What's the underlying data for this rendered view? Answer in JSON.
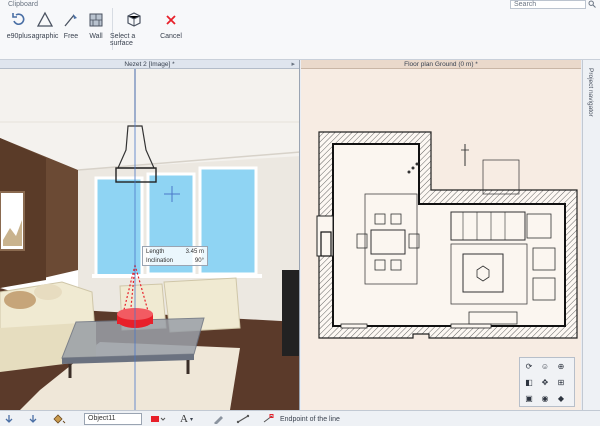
{
  "ribbon": {
    "group_label": "Clipboard",
    "search_placeholder": "Search",
    "tools": [
      {
        "label": "e90plus"
      },
      {
        "label": "agraphic"
      },
      {
        "label": "Free"
      },
      {
        "label": "Wall"
      },
      {
        "label": "Select a surface"
      },
      {
        "label": "Cancel"
      }
    ]
  },
  "view3d": {
    "title": "Nezet 2 [Image] *",
    "measure": {
      "length_label": "Length",
      "length_value": "3.45 m",
      "inclination_label": "Inclination",
      "inclination_value": "90°"
    }
  },
  "floorplan": {
    "title": "Floor plan Ground (0 m) *"
  },
  "navigator": {
    "label": "Project navigator"
  },
  "statusbar": {
    "layer_field": "Object11",
    "hint": "Endpoint of the line"
  },
  "colors": {
    "accent_red": "#e8202a",
    "plan_bg": "#f7ece3",
    "wall_hatch": "#2a2a2a"
  }
}
